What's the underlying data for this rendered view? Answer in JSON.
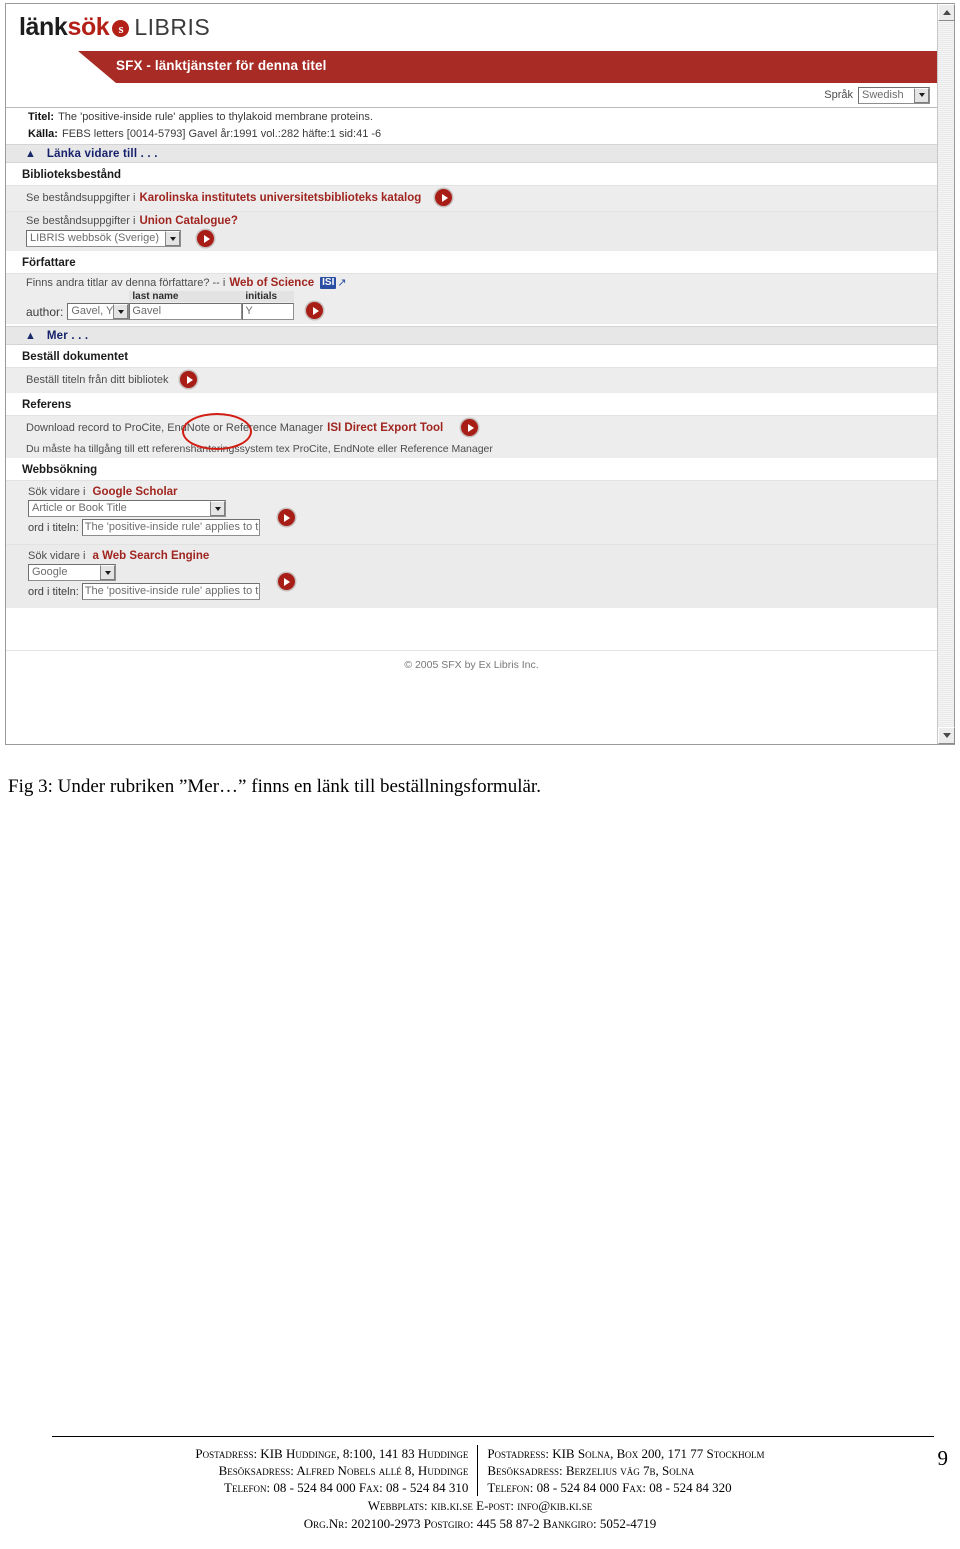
{
  "window": {
    "logo": {
      "part1": "länk",
      "part2": "sök",
      "swirl": "swirl-icon",
      "suffix": "LIBRIS"
    },
    "banner_title": "SFX - länktjänster för denna titel",
    "language": {
      "label": "Språk",
      "value": "Swedish"
    },
    "scrollbar": {
      "up": "scroll-up-icon",
      "down": "scroll-down-icon"
    },
    "footer": "© 2005 SFX by Ex Libris Inc."
  },
  "record": {
    "title_label": "Titel:",
    "title_value": "The 'positive-inside rule' applies to thylakoid membrane proteins.",
    "source_label": "Källa:",
    "source_value": "FEBS letters [0014-5793] Gavel år:1991 vol.:282 häfte:1 sid:41 -6"
  },
  "collapse_bars": {
    "link_further": "Länka vidare till . . .",
    "more": "Mer . . ."
  },
  "sections": {
    "holdings": {
      "heading": "Biblioteksbestånd",
      "row1": {
        "prefix": "Se beståndsuppgifter i",
        "service": "Karolinska institutets universitetsbiblioteks katalog"
      },
      "row2": {
        "prefix": "Se beståndsuppgifter i",
        "service": "Union Catalogue?",
        "select_value": "LIBRIS webbsök (Sverige)"
      }
    },
    "author": {
      "heading": "Författare",
      "prefix": "Finns andra titlar av denna författare? -- i",
      "service": "Web of Science",
      "isi_badge": "ISI",
      "label": "author:",
      "select_value": "Gavel, Y",
      "lastname_caption": "last name",
      "lastname_value": "Gavel",
      "initials_caption": "initials",
      "initials_value": "Y"
    },
    "order": {
      "heading": "Beställ dokumentet",
      "row1": {
        "text": "Beställ titeln från ditt bibliotek"
      }
    },
    "reference": {
      "heading": "Referens",
      "row1": {
        "prefix": "Download record to ProCite, EndNote or Reference Manager",
        "service": "ISI Direct Export Tool"
      },
      "note": "Du måste ha tillgång till ett referenshanteringssystem tex ProCite, EndNote eller Reference Manager"
    },
    "websearch": {
      "heading": "Webbsökning",
      "scholar": {
        "prefix": "Sök vidare i",
        "service": "Google Scholar",
        "select_value": "Article or Book Title",
        "field_label": "ord i titeln:",
        "field_value": "The 'positive-inside rule' applies to th"
      },
      "engine": {
        "prefix": "Sök vidare i",
        "service": "a Web Search Engine",
        "select_value": "Google",
        "field_label": "ord i titeln:",
        "field_value": "The 'positive-inside rule' applies to th"
      }
    }
  },
  "caption": "Fig 3: Under rubriken ”Mer…” finns en länk till beställningsformulär.",
  "page_footer": {
    "page_number": "9",
    "left": [
      "Postadress: KIB Huddinge, 8:100, 141 83 Huddinge",
      "Besöksadress: Alfred Nobels allé 8, Huddinge",
      "Telefon: 08 - 524 84 000  Fax: 08 - 524 84 310"
    ],
    "right": [
      "Postadress: KIB Solna, Box 200, 171 77 Stockholm",
      "Besöksadress: Berzelius väg 7b, Solna",
      "Telefon: 08 - 524 84 000  Fax: 08 - 524 84 320"
    ],
    "center": [
      "Webbplats: kib.ki.se  E-post: info@kib.ki.se",
      "Org.Nr: 202100-2973  Postgiro: 445 58 87-2  Bankgiro: 5052-4719"
    ]
  }
}
